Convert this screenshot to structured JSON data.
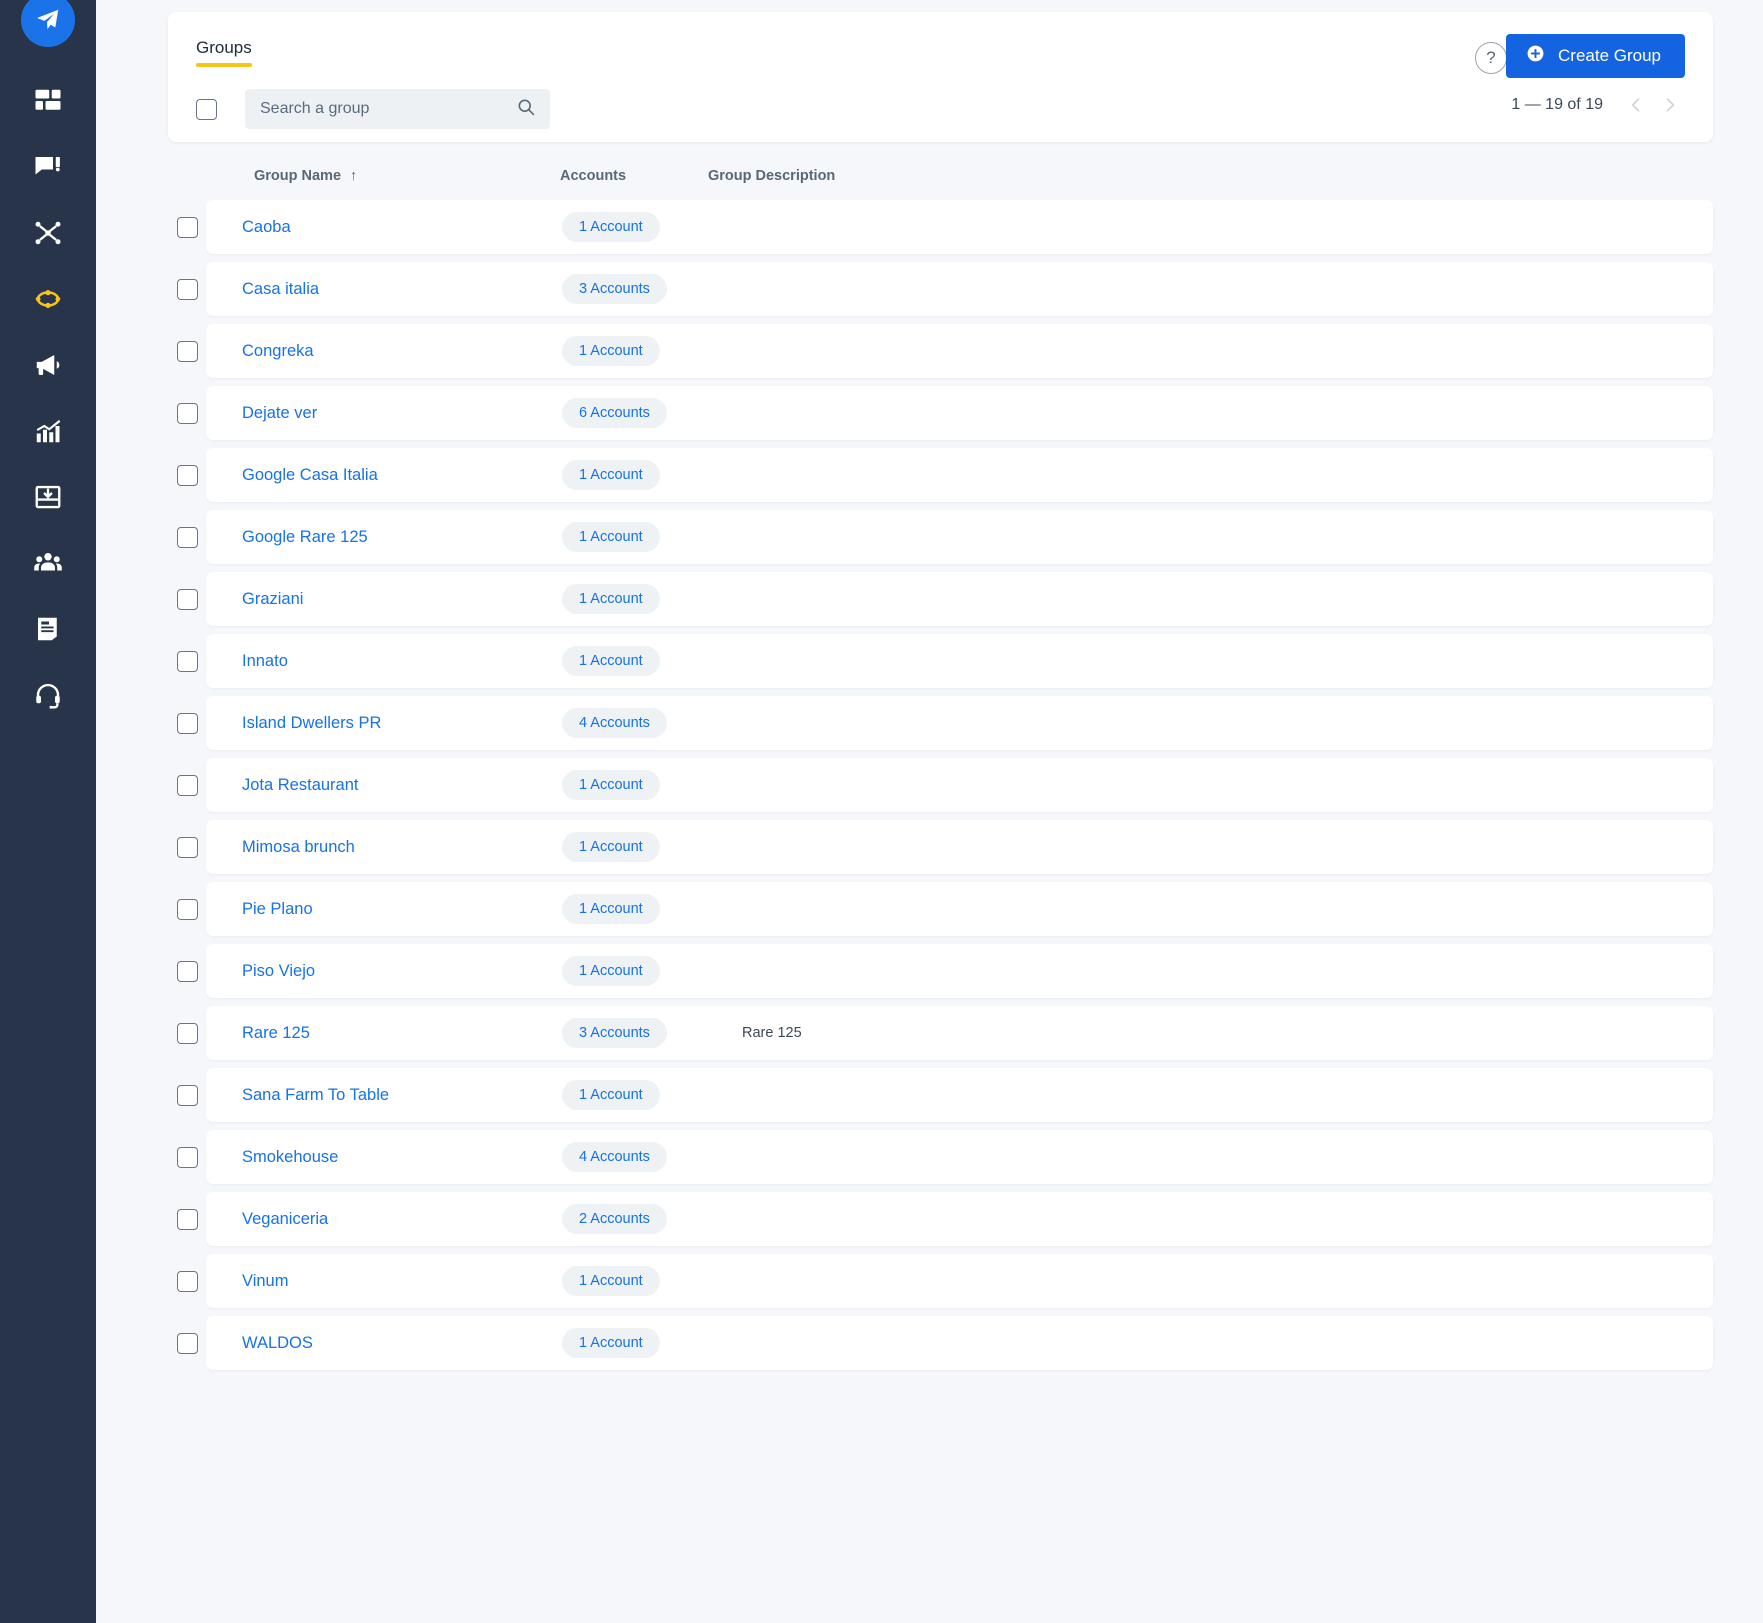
{
  "sidebar": {
    "logo": {
      "icon": "paper-plane-icon",
      "color": "#1a73e8"
    },
    "items": [
      {
        "icon": "dashboard-grid-icon",
        "active": false
      },
      {
        "icon": "chat-edit-icon",
        "active": false
      },
      {
        "icon": "network-share-icon",
        "active": false
      },
      {
        "icon": "diamond-ring-icon",
        "active": true
      },
      {
        "icon": "megaphone-icon",
        "active": false
      },
      {
        "icon": "analytics-chart-icon",
        "active": false
      },
      {
        "icon": "inbox-download-icon",
        "active": false
      },
      {
        "icon": "people-group-icon",
        "active": false
      },
      {
        "icon": "document-icon",
        "active": false
      },
      {
        "icon": "headset-support-icon",
        "active": false
      }
    ],
    "background": "#273449",
    "active_color": "#f5c518"
  },
  "header": {
    "tabs": [
      {
        "label": "Groups",
        "active": true
      }
    ],
    "select_all_checkbox": {
      "checked": false
    },
    "search": {
      "value": "",
      "placeholder": "Search a group",
      "icon": "search-icon"
    },
    "help_button": {
      "label": "?",
      "icon": "help-circle-icon"
    },
    "create_button": {
      "label": "Create Group",
      "icon": "plus-circle-icon",
      "color": "#1463e0"
    },
    "pagination": {
      "range_label": "1 — 19 of 19",
      "prev_icon": "chevron-left-icon",
      "next_icon": "chevron-right-icon"
    },
    "tab_underline_color": "#f5c518"
  },
  "table": {
    "columns": [
      {
        "key": "name",
        "label": "Group Name",
        "sort": "↑",
        "sorted": true
      },
      {
        "key": "accounts",
        "label": "Accounts"
      },
      {
        "key": "description",
        "label": "Group Description"
      }
    ],
    "rows": [
      {
        "name": "Caoba",
        "accounts": "1 Account",
        "description": ""
      },
      {
        "name": "Casa italia",
        "accounts": "3 Accounts",
        "description": ""
      },
      {
        "name": "Congreka",
        "accounts": "1 Account",
        "description": ""
      },
      {
        "name": "Dejate ver",
        "accounts": "6 Accounts",
        "description": ""
      },
      {
        "name": "Google Casa Italia",
        "accounts": "1 Account",
        "description": ""
      },
      {
        "name": "Google Rare 125",
        "accounts": "1 Account",
        "description": ""
      },
      {
        "name": "Graziani",
        "accounts": "1 Account",
        "description": ""
      },
      {
        "name": "Innato",
        "accounts": "1 Account",
        "description": ""
      },
      {
        "name": "Island Dwellers PR",
        "accounts": "4 Accounts",
        "description": ""
      },
      {
        "name": "Jota Restaurant",
        "accounts": "1 Account",
        "description": ""
      },
      {
        "name": "Mimosa brunch",
        "accounts": "1 Account",
        "description": ""
      },
      {
        "name": "Pie Plano",
        "accounts": "1 Account",
        "description": ""
      },
      {
        "name": "Piso Viejo",
        "accounts": "1 Account",
        "description": ""
      },
      {
        "name": "Rare 125",
        "accounts": "3 Accounts",
        "description": "Rare 125"
      },
      {
        "name": "Sana Farm To Table",
        "accounts": "1 Account",
        "description": ""
      },
      {
        "name": "Smokehouse",
        "accounts": "4 Accounts",
        "description": ""
      },
      {
        "name": "Veganiceria",
        "accounts": "2 Accounts",
        "description": ""
      },
      {
        "name": "Vinum",
        "accounts": "1 Account",
        "description": ""
      },
      {
        "name": "WALDOS",
        "accounts": "1 Account",
        "description": ""
      }
    ]
  },
  "colors": {
    "page_background": "#f5f7fa",
    "card": "#ffffff",
    "link": "#1672e8",
    "pill_background": "#eef2f4",
    "accent_yellow": "#f5c518",
    "primary_blue": "#1463e0",
    "sidebar": "#273449"
  }
}
